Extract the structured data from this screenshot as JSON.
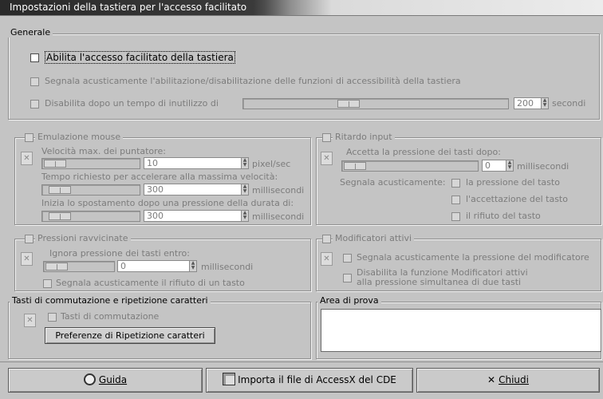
{
  "window": {
    "title": "Impostazioni della tastiera per l'accesso facilitato"
  },
  "generale": {
    "legend": "Generale",
    "enable_label": "Abilita l'accesso facilitato della tastiera",
    "beep_label": "Segnala acusticamente l'abilitazione/disabilitazione delle funzioni di accessibilità della tastiera",
    "disable_label": "Disabilita dopo un tempo di inutilizzo di",
    "disable_value": "200",
    "disable_unit": "secondi"
  },
  "mouse": {
    "legend": "Emulazione mouse",
    "speed_label": "Velocità max. dei puntatore:",
    "speed_value": "10",
    "speed_unit": "pixel/sec",
    "accel_label": "Tempo richiesto per accelerare alla massima velocità:",
    "accel_value": "300",
    "accel_unit": "millisecondi",
    "delay_label": "Inizia lo spostamento dopo una pressione della durata di:",
    "delay_value": "300",
    "delay_unit": "millisecondi"
  },
  "input_delay": {
    "legend": "Ritardo input",
    "accept_label": "Accetta la pressione dei tasti dopo:",
    "accept_value": "0",
    "accept_unit": "millisecondi",
    "beep_label": "Segnala acusticamente:",
    "opt_press": "la pressione del tasto",
    "opt_accept": "l'accettazione del tasto",
    "opt_reject": "il rifiuto del tasto"
  },
  "bounce": {
    "legend": "Pressioni ravvicinate",
    "ignore_label": "Ignora pressione dei tasti entro:",
    "ignore_value": "0",
    "ignore_unit": "millisecondi",
    "beep_reject": "Segnala acusticamente il rifiuto di un tasto"
  },
  "modifiers": {
    "legend": "Modificatori attivi",
    "beep_modifier": "Segnala acusticamente la pressione del modificatore",
    "disable_line1": "Disabilita la funzione Modificatori attivi",
    "disable_line2": "alla pressione simultanea di due tasti"
  },
  "toggle": {
    "legend": "Tasti di commutazione e ripetizione caratteri",
    "toggle_keys": "Tasti di commutazione",
    "repeat_button": "Preferenze di Ripetizione caratteri"
  },
  "test_area": {
    "legend": "Area di prova",
    "value": ""
  },
  "buttons": {
    "help": "Guida",
    "import": "Importa il file di AccessX del CDE",
    "close": "Chiudi"
  }
}
